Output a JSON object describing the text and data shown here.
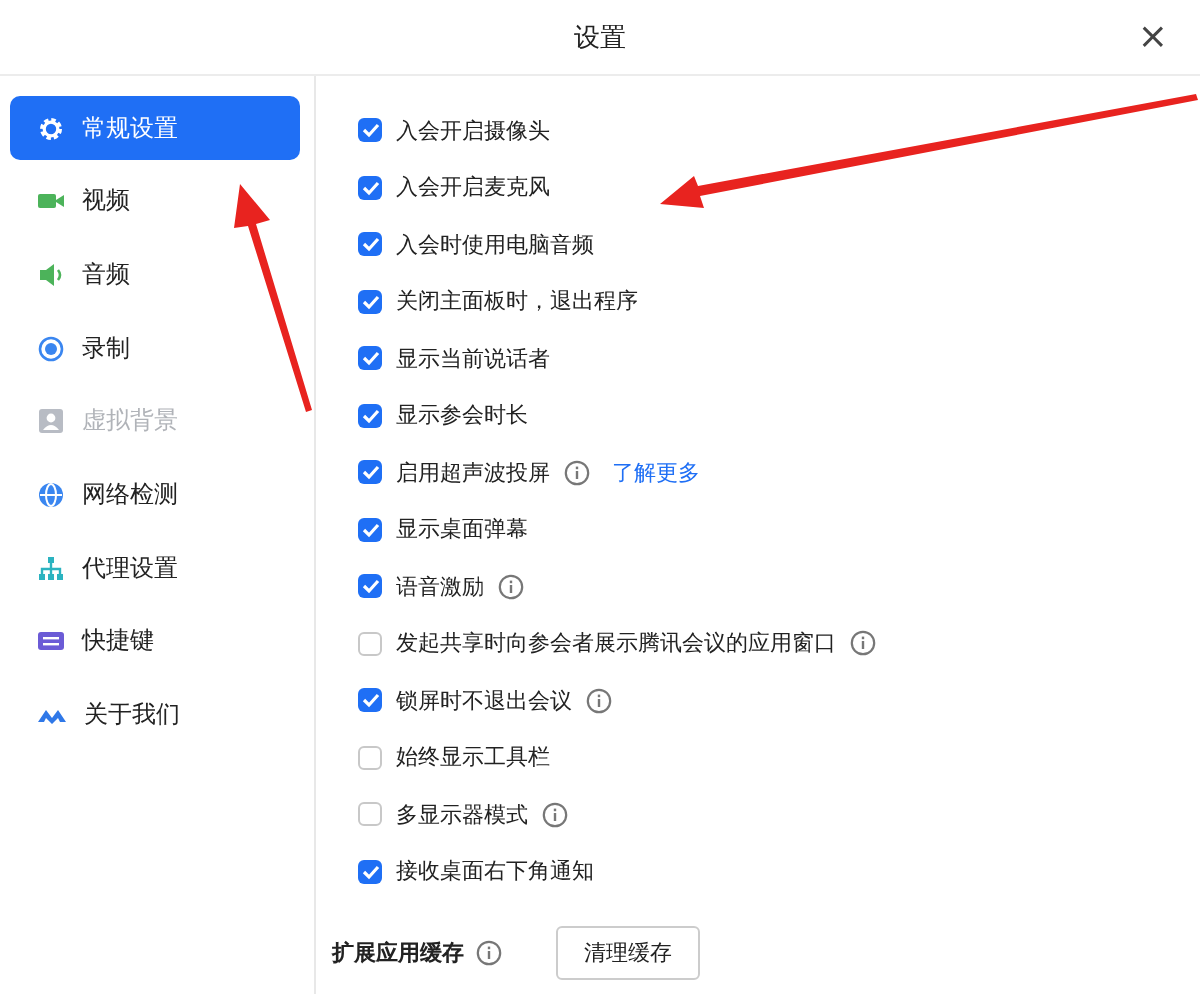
{
  "window": {
    "title": "设置",
    "close": "×"
  },
  "sidebar": {
    "items": [
      {
        "label": "常规设置",
        "selected": true,
        "disabled": false
      },
      {
        "label": "视频",
        "selected": false,
        "disabled": false
      },
      {
        "label": "音频",
        "selected": false,
        "disabled": false
      },
      {
        "label": "录制",
        "selected": false,
        "disabled": false
      },
      {
        "label": "虚拟背景",
        "selected": false,
        "disabled": true
      },
      {
        "label": "网络检测",
        "selected": false,
        "disabled": false
      },
      {
        "label": "代理设置",
        "selected": false,
        "disabled": false
      },
      {
        "label": "快捷键",
        "selected": false,
        "disabled": false
      },
      {
        "label": "关于我们",
        "selected": false,
        "disabled": false
      }
    ]
  },
  "options": [
    {
      "label": "入会开启摄像头",
      "checked": true,
      "info": false
    },
    {
      "label": "入会开启麦克风",
      "checked": true,
      "info": false
    },
    {
      "label": "入会时使用电脑音频",
      "checked": true,
      "info": false
    },
    {
      "label": "关闭主面板时，退出程序",
      "checked": true,
      "info": false
    },
    {
      "label": "显示当前说话者",
      "checked": true,
      "info": false
    },
    {
      "label": "显示参会时长",
      "checked": true,
      "info": false
    },
    {
      "label": "启用超声波投屏",
      "checked": true,
      "info": true,
      "link": "了解更多"
    },
    {
      "label": "显示桌面弹幕",
      "checked": true,
      "info": false
    },
    {
      "label": "语音激励",
      "checked": true,
      "info": true
    },
    {
      "label": "发起共享时向参会者展示腾讯会议的应用窗口",
      "checked": false,
      "info": true
    },
    {
      "label": "锁屏时不退出会议",
      "checked": true,
      "info": true
    },
    {
      "label": "始终显示工具栏",
      "checked": false,
      "info": false
    },
    {
      "label": "多显示器模式",
      "checked": false,
      "info": true
    },
    {
      "label": "接收桌面右下角通知",
      "checked": true,
      "info": false
    }
  ],
  "cache": {
    "label": "扩展应用缓存",
    "info": true,
    "button": "清理缓存"
  }
}
